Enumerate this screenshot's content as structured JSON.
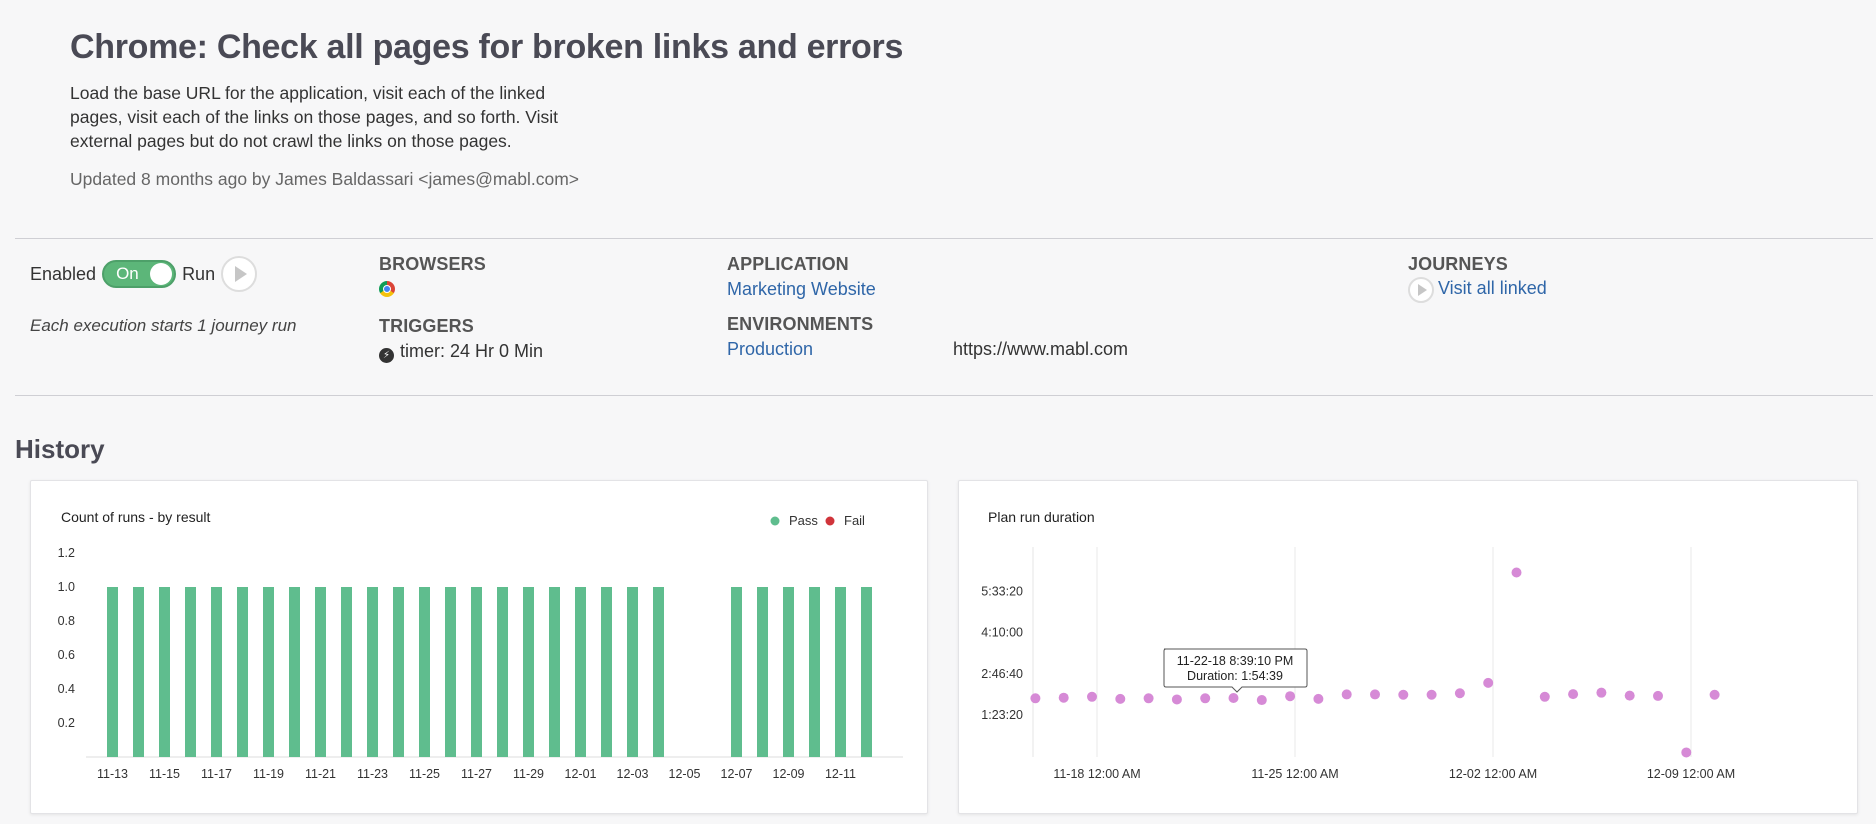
{
  "header": {
    "title": "Chrome: Check all pages for broken links and errors",
    "description": "Load the base URL for the application, visit each of the linked pages, visit each of the links on those pages, and so forth. Visit external pages but do not crawl the links on those pages.",
    "updated": "Updated 8 months ago by James Baldassari <james@mabl.com>"
  },
  "plan": {
    "enabled_label": "Enabled",
    "toggle_label": "On",
    "run_label": "Run",
    "execution_note": "Each execution starts 1 journey run"
  },
  "browsers": {
    "label": "BROWSERS",
    "icon": "chrome-icon"
  },
  "triggers": {
    "label": "TRIGGERS",
    "value": "timer: 24 Hr 0 Min"
  },
  "application": {
    "label": "APPLICATION",
    "value": "Marketing Website"
  },
  "environments": {
    "label": "ENVIRONMENTS",
    "name": "Production",
    "url": "https://www.mabl.com"
  },
  "journeys": {
    "label": "JOURNEYS",
    "item": "Visit all linked"
  },
  "history": {
    "title": "History"
  },
  "colors": {
    "pass": "#5fbd8e",
    "fail": "#d0343a",
    "duration": "#d68ad6",
    "toggle": "#5cb679",
    "link": "#2f66a8"
  },
  "chart_data": [
    {
      "type": "bar",
      "title": "Count of runs - by result",
      "legend": [
        "Pass",
        "Fail"
      ],
      "legend_position": "top-right",
      "y_ticks": [
        "0.2",
        "0.4",
        "0.6",
        "0.8",
        "1.0",
        "1.2"
      ],
      "ylim": [
        0,
        1.2
      ],
      "categories": [
        "11-13",
        "11-14",
        "11-15",
        "11-16",
        "11-17",
        "11-18",
        "11-19",
        "11-20",
        "11-21",
        "11-22",
        "11-23",
        "11-24",
        "11-25",
        "11-26",
        "11-27",
        "11-28",
        "11-29",
        "11-30",
        "12-01",
        "12-02",
        "12-03",
        "12-04",
        "12-05",
        "12-06",
        "12-07",
        "12-08",
        "12-09",
        "12-10",
        "12-11",
        "12-12"
      ],
      "x_tick_labels": [
        "11-13",
        "11-15",
        "11-17",
        "11-19",
        "11-21",
        "11-23",
        "11-25",
        "11-27",
        "11-29",
        "12-01",
        "12-03",
        "12-05",
        "12-07",
        "12-09",
        "12-11"
      ],
      "series": [
        {
          "name": "Pass",
          "values": [
            1,
            1,
            1,
            1,
            1,
            1,
            1,
            1,
            1,
            1,
            1,
            1,
            1,
            1,
            1,
            1,
            1,
            1,
            1,
            1,
            1,
            1,
            0,
            0,
            1,
            1,
            1,
            1,
            1,
            1
          ]
        },
        {
          "name": "Fail",
          "values": [
            0,
            0,
            0,
            0,
            0,
            0,
            0,
            0,
            0,
            0,
            0,
            0,
            0,
            0,
            0,
            0,
            0,
            0,
            0,
            0,
            0,
            0,
            0,
            0,
            0,
            0,
            0,
            0,
            0,
            0
          ]
        }
      ]
    },
    {
      "type": "scatter",
      "title": "Plan run duration",
      "y_ticks": [
        "1:23:20",
        "2:46:40",
        "4:10:00",
        "5:33:20"
      ],
      "x_ticks": [
        "11-18 12:00 AM",
        "11-25 12:00 AM",
        "12-02 12:00 AM",
        "12-09 12:00 AM"
      ],
      "grid": true,
      "tooltip": {
        "line1": "11-22-18 8:39:10 PM",
        "line2": "Duration: 1:54:39"
      },
      "points": [
        {
          "x": "11-16",
          "y_hours": 1.95
        },
        {
          "x": "11-17",
          "y_hours": 1.97
        },
        {
          "x": "11-18",
          "y_hours": 2.0
        },
        {
          "x": "11-19",
          "y_hours": 1.93
        },
        {
          "x": "11-20",
          "y_hours": 1.95
        },
        {
          "x": "11-21",
          "y_hours": 1.91
        },
        {
          "x": "11-22",
          "y_hours": 1.95
        },
        {
          "x": "11-23",
          "y_hours": 1.96
        },
        {
          "x": "11-24",
          "y_hours": 1.89
        },
        {
          "x": "11-25",
          "y_hours": 2.02
        },
        {
          "x": "11-26",
          "y_hours": 1.93
        },
        {
          "x": "11-27",
          "y_hours": 2.08
        },
        {
          "x": "11-28",
          "y_hours": 2.08
        },
        {
          "x": "11-29",
          "y_hours": 2.07
        },
        {
          "x": "11-30",
          "y_hours": 2.07
        },
        {
          "x": "12-01",
          "y_hours": 2.12
        },
        {
          "x": "12-02",
          "y_hours": 2.47
        },
        {
          "x": "12-03",
          "y_hours": 6.2
        },
        {
          "x": "12-04",
          "y_hours": 2.0
        },
        {
          "x": "12-05",
          "y_hours": 2.09
        },
        {
          "x": "12-06",
          "y_hours": 2.14
        },
        {
          "x": "12-07",
          "y_hours": 2.04
        },
        {
          "x": "12-08",
          "y_hours": 2.03
        },
        {
          "x": "12-09",
          "y_hours": 0.12
        },
        {
          "x": "12-10",
          "y_hours": 2.07
        }
      ]
    }
  ]
}
